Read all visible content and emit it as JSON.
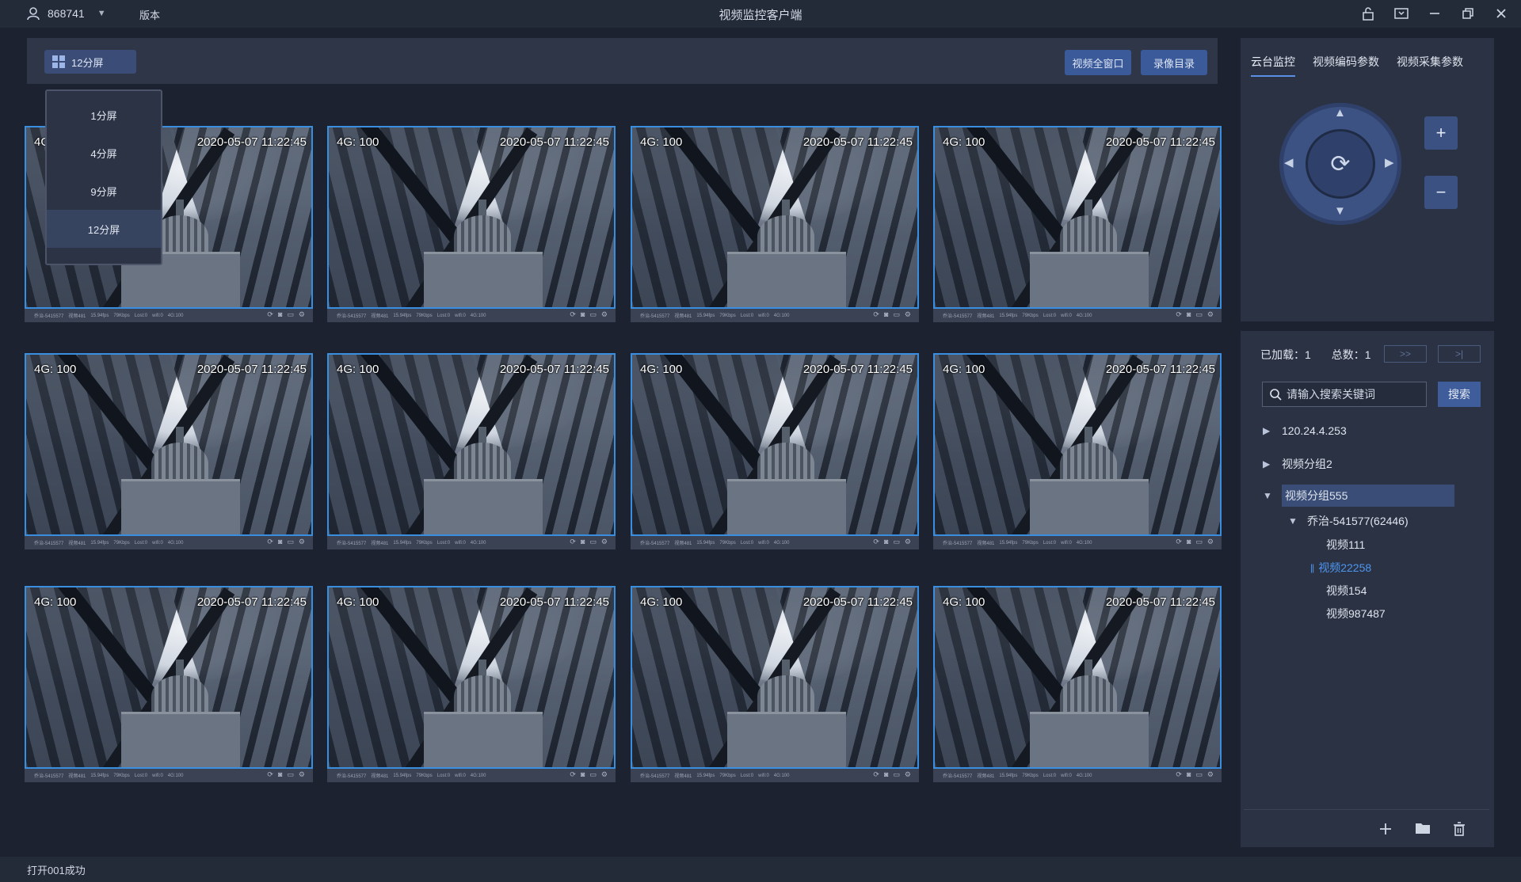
{
  "titlebar": {
    "user_id": "868741",
    "version_label": "版本",
    "app_title": "视频监控客户端"
  },
  "toolbar": {
    "layout_label": "12分屏",
    "fullscreen_label": "视频全窗口",
    "record_dir_label": "录像目录"
  },
  "layout_menu": {
    "options": [
      "1分屏",
      "4分屏",
      "9分屏",
      "12分屏"
    ],
    "selected": "12分屏"
  },
  "video_tiles": {
    "signal": "4G: 100",
    "timestamp": "2020-05-07 11:22:45",
    "status_line": [
      "乔治-5415577",
      "视频481",
      "15.94fps",
      "79Kbps",
      "Lost:0",
      "wifi:0",
      "4G:100"
    ],
    "count": 12
  },
  "ptz_panel": {
    "tabs": [
      "云台监控",
      "视频编码参数",
      "视频采集参数"
    ],
    "active_tab": "云台监控",
    "zoom_in_label": "+",
    "zoom_out_label": "−"
  },
  "device_tree": {
    "loaded_label": "已加载：1",
    "total_label": "总数：1",
    "next_label": ">>",
    "last_label": ">|",
    "search_placeholder": "请输入搜索关键词",
    "search_button": "搜索",
    "nodes": [
      {
        "label": "120.24.4.253",
        "expanded": false
      },
      {
        "label": "视频分组2",
        "expanded": false
      },
      {
        "label": "视频分组555",
        "expanded": true,
        "selected": true
      }
    ],
    "sub_group": "乔治-541577(62446)",
    "videos": [
      "视频111",
      "视频22258",
      "视频154",
      "视频987487"
    ],
    "playing_video": "视频22258"
  },
  "footer": {
    "status": "打开001成功"
  },
  "colors": {
    "accent": "#3a8ee0",
    "active_text": "#4d96f0",
    "button_blue": "#3b5a9a"
  }
}
